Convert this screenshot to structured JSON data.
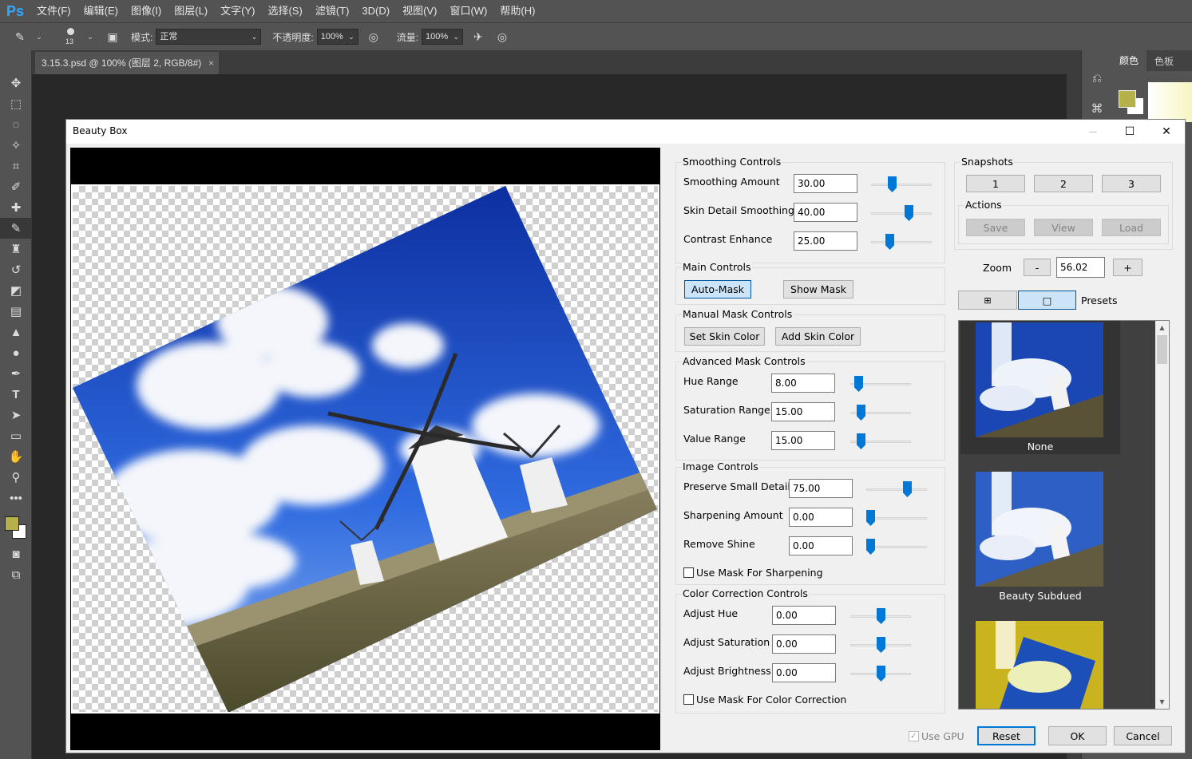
{
  "ps": {
    "logo": "Ps",
    "menus": [
      "文件(F)",
      "编辑(E)",
      "图像(I)",
      "图层(L)",
      "文字(Y)",
      "选择(S)",
      "滤镜(T)",
      "3D(D)",
      "视图(V)",
      "窗口(W)",
      "帮助(H)"
    ],
    "options": {
      "brush_size": "13",
      "mode_label": "模式:",
      "mode_value": "正常",
      "opacity_label": "不透明度:",
      "opacity_value": "100%",
      "flow_label": "流量:",
      "flow_value": "100%"
    },
    "doc_tab": "3.15.3.psd @ 100% (图层 2, RGB/8#)",
    "doc_tab_close": "×",
    "color_panel": {
      "tab_color": "颜色",
      "tab_swatches": "色板"
    },
    "foreground_color": "#b5b04a",
    "background_color": "#ffffff"
  },
  "dialog": {
    "title": "Beauty Box",
    "window_buttons": {
      "minimize": "—",
      "maximize": "☐",
      "close": "✕"
    },
    "smoothing": {
      "title": "Smoothing Controls",
      "rows": [
        {
          "label": "Smoothing Amount",
          "value": "30.00",
          "slider": 0.33
        },
        {
          "label": "Skin Detail Smoothing",
          "value": "40.00",
          "slider": 0.64
        },
        {
          "label": "Contrast Enhance",
          "value": "25.00",
          "slider": 0.28
        }
      ]
    },
    "main_controls": {
      "title": "Main Controls",
      "auto_mask": "Auto-Mask",
      "show_mask": "Show Mask"
    },
    "manual_mask": {
      "title": "Manual Mask Controls",
      "set_skin": "Set Skin Color",
      "add_skin": "Add Skin Color"
    },
    "advanced_mask": {
      "title": "Advanced Mask Controls",
      "rows": [
        {
          "label": "Hue Range",
          "value": "8.00",
          "slider": 0.08
        },
        {
          "label": "Saturation Range",
          "value": "15.00",
          "slider": 0.13
        },
        {
          "label": "Value Range",
          "value": "15.00",
          "slider": 0.13
        }
      ]
    },
    "image_controls": {
      "title": "Image Controls",
      "rows": [
        {
          "label": "Preserve Small Detail",
          "value": "75.00",
          "slider": 0.7
        },
        {
          "label": "Sharpening Amount",
          "value": "0.00",
          "slider": 0.0
        },
        {
          "label": "Remove Shine",
          "value": "0.00",
          "slider": 0.0
        }
      ],
      "use_mask": "Use Mask For Sharpening"
    },
    "color_correction": {
      "title": "Color Correction Controls",
      "rows": [
        {
          "label": "Adjust Hue",
          "value": "0.00",
          "slider": 0.5
        },
        {
          "label": "Adjust Saturation",
          "value": "0.00",
          "slider": 0.5
        },
        {
          "label": "Adjust Brightness",
          "value": "0.00",
          "slider": 0.5
        }
      ],
      "use_mask": "Use Mask For Color Correction"
    },
    "snapshots": {
      "title": "Snapshots",
      "buttons": [
        "1",
        "2",
        "3"
      ]
    },
    "actions": {
      "title": "Actions",
      "save": "Save",
      "view": "View",
      "load": "Load"
    },
    "zoom": {
      "label": "Zoom",
      "minus": "-",
      "value": "56.02",
      "plus": "+"
    },
    "presets": {
      "label": "Presets",
      "view_grid": "⊞",
      "view_single": "□",
      "items": [
        "None",
        "Beauty Subdued"
      ]
    },
    "footer": {
      "use_gpu": "Use GPU",
      "reset": "Reset",
      "ok": "OK",
      "cancel": "Cancel"
    }
  }
}
